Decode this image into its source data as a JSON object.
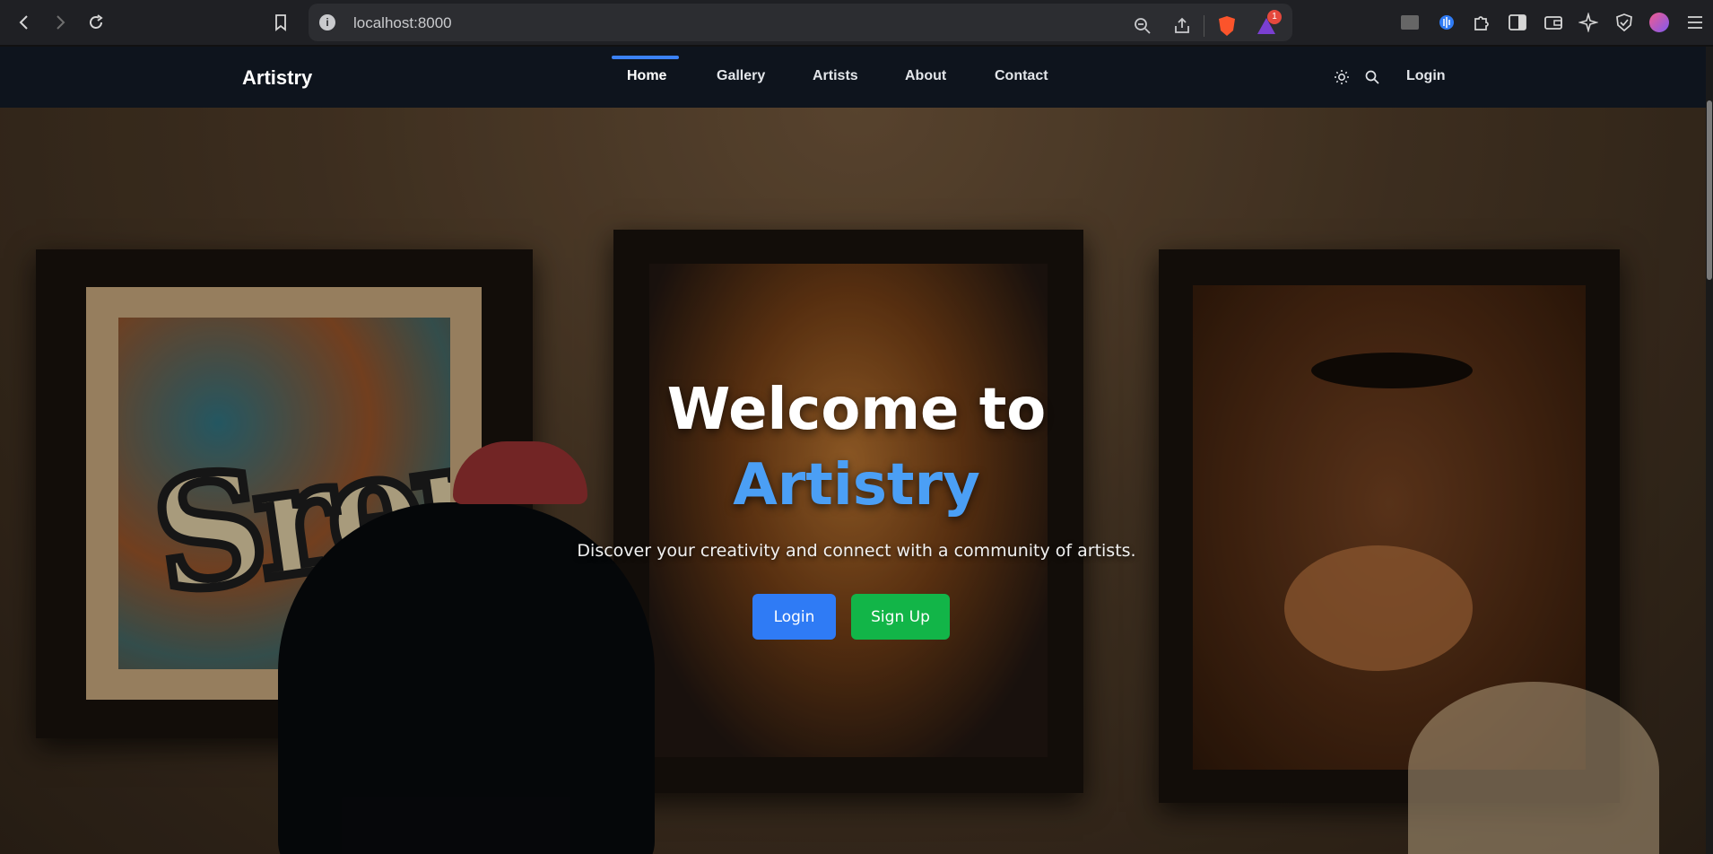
{
  "browser": {
    "url": "localhost:8000",
    "notification_count": "1"
  },
  "nav": {
    "brand": "Artistry",
    "links": [
      "Home",
      "Gallery",
      "Artists",
      "About",
      "Contact"
    ],
    "login": "Login"
  },
  "hero": {
    "title_line1": "Welcome to",
    "title_line2": "Artistry",
    "subtitle": "Discover your creativity and connect with a community of artists.",
    "login_button": "Login",
    "signup_button": "Sign Up",
    "graffiti_text": "Srep"
  },
  "colors": {
    "accent": "#3b82f6",
    "title_highlight": "#4b9ff5",
    "signup": "#12b548",
    "nav_bg": "#0e141d"
  }
}
